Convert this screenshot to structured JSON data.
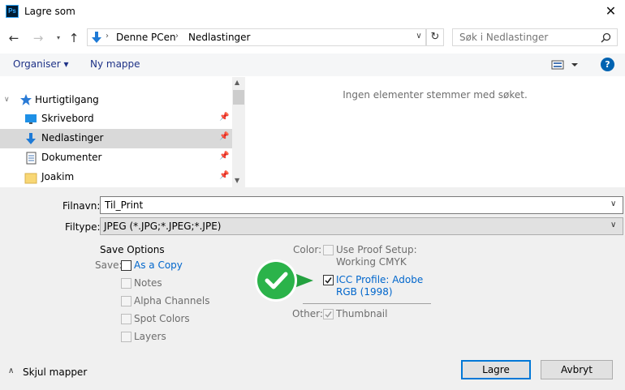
{
  "window": {
    "title": "Lagre som",
    "app_icon": "Ps"
  },
  "nav": {
    "path": [
      "Denne PCen",
      "Nedlastinger"
    ],
    "search_placeholder": "Søk i Nedlastinger"
  },
  "toolbar": {
    "organize": "Organiser ▾",
    "new_folder": "Ny mappe"
  },
  "navpane": {
    "quick_access": "Hurtigtilgang",
    "items": [
      {
        "label": "Skrivebord",
        "icon": "desktop-icon"
      },
      {
        "label": "Nedlastinger",
        "icon": "download-icon"
      },
      {
        "label": "Dokumenter",
        "icon": "documents-icon"
      },
      {
        "label": "Joakim",
        "icon": "folder-icon"
      }
    ]
  },
  "content": {
    "empty_message": "Ingen elementer stemmer med søket."
  },
  "form": {
    "filename_label": "Filnavn:",
    "filename_value": "Til_Print",
    "filetype_label": "Filtype:",
    "filetype_value": "JPEG (*.JPG;*.JPEG;*.JPE)"
  },
  "options": {
    "title": "Save Options",
    "save_label": "Save:",
    "as_copy": "As a Copy",
    "notes": "Notes",
    "alpha": "Alpha Channels",
    "spot": "Spot Colors",
    "layers": "Layers",
    "color_label": "Color:",
    "proof_line1": "Use Proof Setup:",
    "proof_line2": "Working CMYK",
    "icc_line1": "ICC Profile:  Adobe",
    "icc_line2": "RGB (1998)",
    "icc_checked": true,
    "other_label": "Other:",
    "thumbnail": "Thumbnail"
  },
  "footer": {
    "hide_folders": "Skjul mapper",
    "save": "Lagre",
    "cancel": "Avbryt"
  },
  "colors": {
    "accent": "#0078d7",
    "badge_green": "#2bb34a",
    "selection": "#d9d9d9"
  }
}
